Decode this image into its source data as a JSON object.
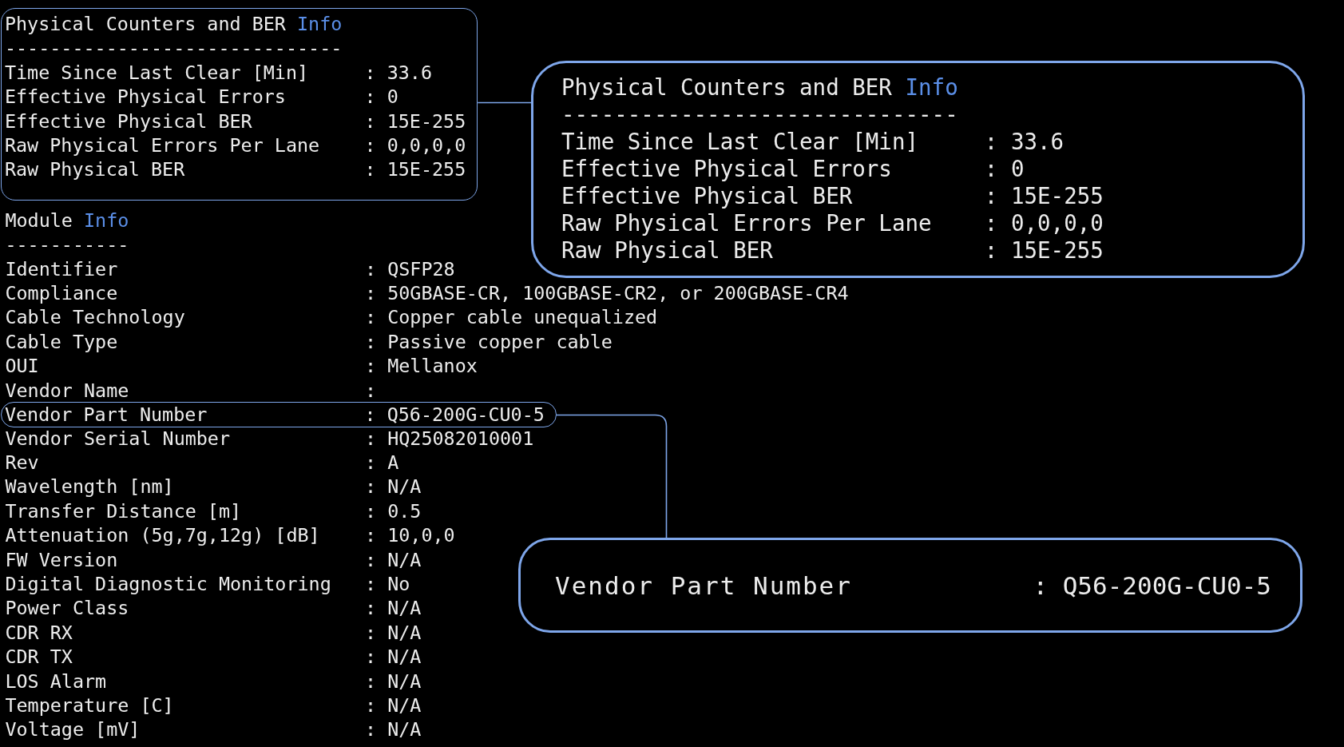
{
  "terminal": {
    "sections": [
      {
        "title": "Physical Counters and BER",
        "title_tag": "Info",
        "rule": "------------------------------",
        "separator": ":",
        "highlighted": true,
        "fields": [
          {
            "label": "Time Since Last Clear [Min]",
            "value": "33.6",
            "highlighted": false
          },
          {
            "label": "Effective Physical Errors",
            "value": "0",
            "highlighted": false
          },
          {
            "label": "Effective Physical BER",
            "value": "15E-255",
            "highlighted": false
          },
          {
            "label": "Raw Physical Errors Per Lane",
            "value": "0,0,0,0",
            "highlighted": false
          },
          {
            "label": "Raw Physical BER",
            "value": "15E-255",
            "highlighted": false
          }
        ]
      },
      {
        "title": "Module",
        "title_tag": "Info",
        "rule": "-----------",
        "separator": ":",
        "highlighted": false,
        "fields": [
          {
            "label": "Identifier",
            "value": "QSFP28",
            "highlighted": false
          },
          {
            "label": "Compliance",
            "value": "50GBASE-CR, 100GBASE-CR2, or 200GBASE-CR4",
            "highlighted": false
          },
          {
            "label": "Cable Technology",
            "value": "Copper cable unequalized",
            "highlighted": false
          },
          {
            "label": "Cable Type",
            "value": "Passive copper cable",
            "highlighted": false
          },
          {
            "label": "OUI",
            "value": "Mellanox",
            "highlighted": false
          },
          {
            "label": "Vendor Name",
            "highlighted": false
          },
          {
            "label": "Vendor Part Number",
            "value": "Q56-200G-CU0-5",
            "highlighted": true
          },
          {
            "label": "Vendor Serial Number",
            "value": "HQ25082010001",
            "highlighted": false
          },
          {
            "label": "Rev",
            "value": "A",
            "highlighted": false
          },
          {
            "label": "Wavelength [nm]",
            "value": "N/A",
            "highlighted": false
          },
          {
            "label": "Transfer Distance [m]",
            "value": "0.5",
            "highlighted": false
          },
          {
            "label": "Attenuation (5g,7g,12g) [dB]",
            "value": "10,0,0",
            "highlighted": false
          },
          {
            "label": "FW Version",
            "value": "N/A",
            "highlighted": false
          },
          {
            "label": "Digital Diagnostic Monitoring",
            "value": "No",
            "highlighted": false
          },
          {
            "label": "Power Class",
            "value": "N/A",
            "highlighted": false
          },
          {
            "label": "CDR RX",
            "value": "N/A",
            "highlighted": false
          },
          {
            "label": "CDR TX",
            "value": "N/A",
            "highlighted": false
          },
          {
            "label": "LOS Alarm",
            "value": "N/A",
            "highlighted": false
          },
          {
            "label": "Temperature [C]",
            "value": "N/A",
            "highlighted": false
          },
          {
            "label": "Voltage [mV]",
            "value": "N/A",
            "highlighted": false
          }
        ]
      }
    ]
  },
  "callouts": [
    {
      "kind": "section",
      "title": "Physical Counters and BER",
      "title_tag": "Info",
      "rule": "------------------------------",
      "separator": ":",
      "fields": [
        {
          "label": "Time Since Last Clear [Min]",
          "value": "33.6"
        },
        {
          "label": "Effective Physical Errors",
          "value": "0"
        },
        {
          "label": "Effective Physical BER",
          "value": "15E-255"
        },
        {
          "label": "Raw Physical Errors Per Lane",
          "value": "0,0,0,0"
        },
        {
          "label": "Raw Physical BER",
          "value": "15E-255"
        }
      ]
    },
    {
      "kind": "field",
      "separator": ":",
      "fields": [
        {
          "label": "Vendor Part Number",
          "value": "Q56-200G-CU0-5"
        }
      ]
    }
  ]
}
